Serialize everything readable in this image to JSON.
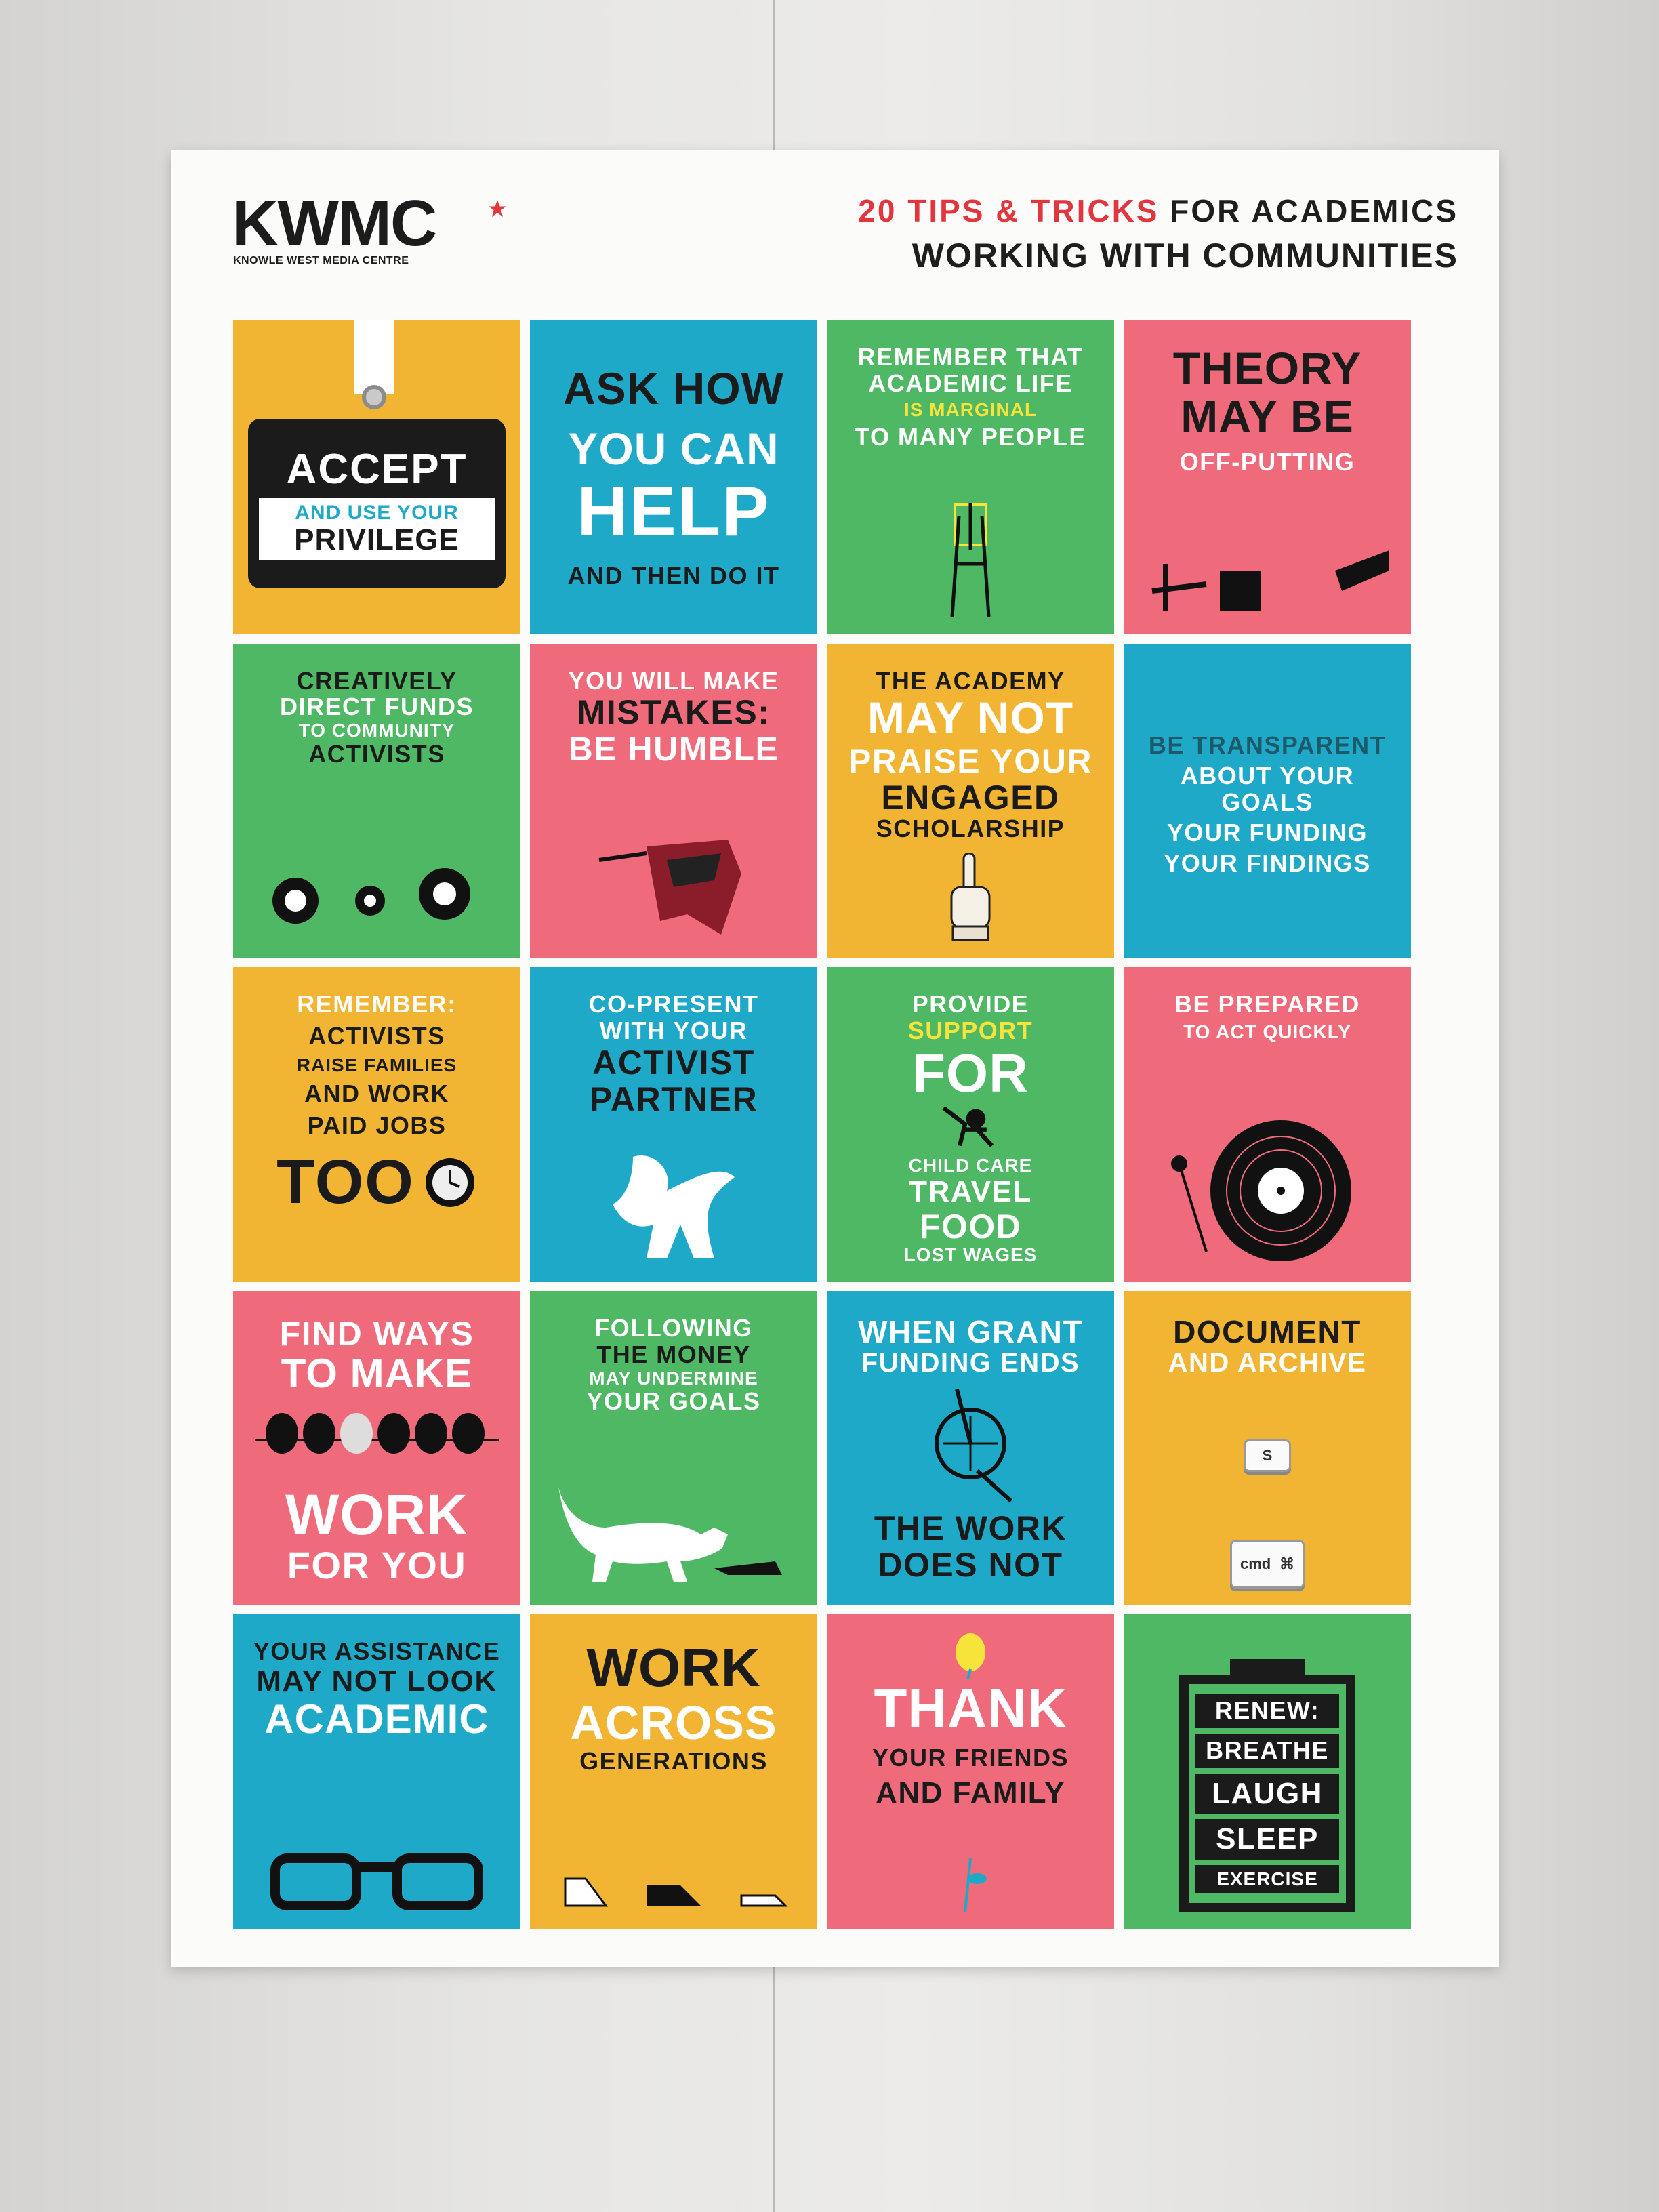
{
  "logo": {
    "name": "KWMC",
    "subtitle": "KNOWLE WEST MEDIA CENTRE"
  },
  "header": {
    "count_label": "20 TIPS & TRICKS",
    "rest_label": "FOR ACADEMICS",
    "line2": "WORKING WITH COMMUNITIES"
  },
  "colors": {
    "yellow": "#f2b533",
    "cyan": "#1fa9c9",
    "green": "#4fb865",
    "pink": "#ef6b7b",
    "red": "#e2363f"
  },
  "tips": {
    "t1": {
      "l1": "ACCEPT",
      "l2": "AND USE YOUR",
      "l3": "PRIVILEGE",
      "icon": "id-badge-icon"
    },
    "t2": {
      "l1": "ASK HOW",
      "l2": "YOU CAN",
      "l3": "HELP",
      "l4": "AND THEN DO IT"
    },
    "t3": {
      "l1": "REMEMBER THAT",
      "l2": "ACADEMIC LIFE",
      "l3": "IS MARGINAL",
      "l4": "TO MANY PEOPLE",
      "icon": "easel-icon"
    },
    "t4": {
      "l1": "THEORY",
      "l2": "MAY BE",
      "l3": "OFF-PUTTING",
      "icon": "falling-person-icon"
    },
    "t5": {
      "l1": "CREATIVELY",
      "l2": "DIRECT FUNDS",
      "l3": "TO COMMUNITY",
      "l4": "ACTIVISTS",
      "icon": "billiard-balls-icon"
    },
    "t6": {
      "l1": "YOU WILL MAKE",
      "l2": "MISTAKES:",
      "l3": "BE HUMBLE",
      "icon": "fallen-crown-icon"
    },
    "t7": {
      "l1": "THE ACADEMY",
      "l2": "MAY NOT",
      "l3": "PRAISE YOUR",
      "l4": "ENGAGED",
      "l5": "SCHOLARSHIP",
      "icon": "pointing-hand-icon"
    },
    "t8": {
      "l1": "BE TRANSPARENT",
      "l2": "ABOUT YOUR GOALS",
      "l3": "YOUR FUNDING",
      "l4": "YOUR FINDINGS"
    },
    "t9": {
      "l1": "REMEMBER:",
      "l2": "ACTIVISTS",
      "l3": "RAISE FAMILIES",
      "l4": "AND WORK",
      "l5": "PAID JOBS",
      "l6": "TOO",
      "icon": "clock-icon"
    },
    "t10": {
      "l1": "CO-PRESENT",
      "l2": "WITH YOUR",
      "l3": "ACTIVIST",
      "l4": "PARTNER",
      "icon": "dancers-icon"
    },
    "t11": {
      "l1": "PROVIDE",
      "l2": "SUPPORT",
      "l3": "FOR",
      "l4": "CHILD CARE",
      "l5": "TRAVEL",
      "l6": "FOOD",
      "l7": "LOST WAGES",
      "icon": "monkey-icon"
    },
    "t12": {
      "l1": "BE PREPARED",
      "l2": "TO ACT QUICKLY",
      "icon": "record-icon"
    },
    "t13": {
      "l1": "FIND WAYS",
      "l2": "TO MAKE",
      "l3": "WORK",
      "l4": "FOR YOU",
      "icon": "abacus-icon"
    },
    "t14": {
      "l1": "FOLLOWING",
      "l2": "THE MONEY",
      "l3": "MAY UNDERMINE",
      "l4": "YOUR GOALS",
      "icon": "cat-icon"
    },
    "t15": {
      "l1": "WHEN GRANT",
      "l2": "FUNDING ENDS",
      "l3": "THE WORK",
      "l4": "DOES NOT",
      "icon": "unicycle-icon"
    },
    "t16": {
      "l1": "DOCUMENT",
      "l2": "AND ARCHIVE",
      "k1": "S",
      "k2": "cmd",
      "k3": "⌘",
      "icon": "keyboard-key-icon"
    },
    "t17": {
      "l1": "YOUR ASSISTANCE",
      "l2": "MAY NOT LOOK",
      "l3": "ACADEMIC",
      "icon": "glasses-icon"
    },
    "t18": {
      "l1": "WORK",
      "l2": "ACROSS",
      "l3": "GENERATIONS",
      "icon": "shoes-icon"
    },
    "t19": {
      "l1": "THANK",
      "l2": "YOUR FRIENDS",
      "l3": "AND FAMILY",
      "icon": "flower-icon"
    },
    "t20": {
      "l1": "RENEW:",
      "l2": "BREATHE",
      "l3": "LAUGH",
      "l4": "SLEEP",
      "l5": "EXERCISE",
      "icon": "battery-icon"
    }
  }
}
